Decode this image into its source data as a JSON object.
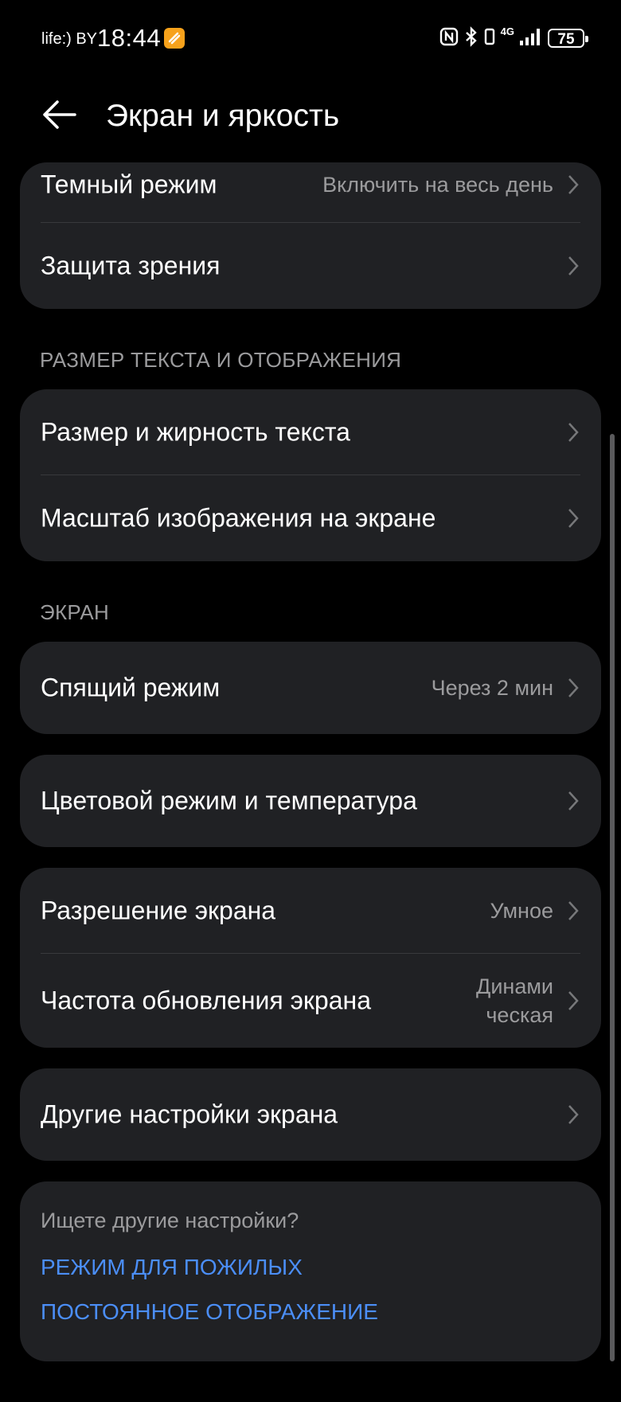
{
  "status_bar": {
    "carrier": "life:) BY",
    "time": "18:44",
    "network": "4G",
    "battery": "75"
  },
  "header": {
    "title": "Экран и яркость"
  },
  "groups": {
    "top": {
      "dark_mode": {
        "label": "Темный режим",
        "value": "Включить на весь день"
      },
      "eye_comfort": {
        "label": "Защита зрения"
      }
    },
    "text_size_section": "РАЗМЕР ТЕКСТА И ОТОБРАЖЕНИЯ",
    "text": {
      "text_size": {
        "label": "Размер и жирность текста"
      },
      "display_scale": {
        "label": "Масштаб изображения на экране"
      }
    },
    "screen_section": "ЭКРАН",
    "sleep": {
      "label": "Спящий режим",
      "value": "Через 2 мин"
    },
    "color": {
      "label": "Цветовой режим и температура"
    },
    "resolution": {
      "resolution": {
        "label": "Разрешение экрана",
        "value": "Умное"
      },
      "refresh_rate": {
        "label": "Частота обновления экрана",
        "value_line1": "Динами",
        "value_line2": "ческая"
      }
    },
    "other": {
      "label": "Другие настройки экрана"
    }
  },
  "footer": {
    "title": "Ищете другие настройки?",
    "link1": "РЕЖИМ ДЛЯ ПОЖИЛЫХ",
    "link2": "ПОСТОЯННОЕ ОТОБРАЖЕНИЕ"
  },
  "colors": {
    "background": "#000000",
    "card": "#202124",
    "link": "#4b8ef7",
    "secondary_text": "#9b9b9d"
  }
}
